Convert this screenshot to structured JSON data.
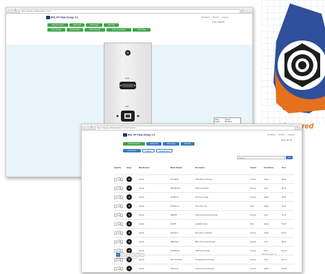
{
  "brand": {
    "tagline": "“Powered",
    "colors": {
      "blue": "#2f4f9a",
      "orange": "#e5711d",
      "camera": "#1d1d1d"
    }
  },
  "back_window": {
    "url": "https://design.rdlfaceplates.com/",
    "app_title": "RDL FP Plate Desigr 2.0",
    "top_links": [
      "Products",
      "Brand",
      "Logout"
    ],
    "toolbar_row1": [
      "Add Connector",
      "Add Label",
      "Add Image",
      "Add Text"
    ],
    "toolbar_row2": [
      "Save Design",
      "Load Design",
      "Order Sample",
      "Order Production",
      "Clear Plate"
    ],
    "price_label": "Price: $60.00",
    "connector_labels": [
      "RGB",
      "USB"
    ],
    "panel": [
      "Plate",
      "Single",
      "Finish",
      "Brushed"
    ]
  },
  "front_window": {
    "url": "https://design.rdlfaceplates.com/connectors",
    "app_title": "RDL FP Plate Desigr 2.0",
    "top_links": [
      "Products",
      "Brand",
      "Logout"
    ],
    "price_label": "Price: $7.78",
    "toolbar_row1": [
      "Add Connector",
      "Add Label",
      "Add Image",
      "Add Text"
    ],
    "tabs": [
      "Connectors",
      "Labels",
      "Accessories"
    ],
    "search_placeholder": "Search",
    "search_button": "Go",
    "columns": [
      "Quantity",
      "Image",
      "Manufacturer",
      "Model Number",
      "Description",
      "Gender",
      "Termination",
      "Price"
    ],
    "rows": [
      [
        "Neutrik",
        "NAUSB-W",
        "USB A/B feed-through",
        "Female",
        "Solder",
        "$8.00"
      ],
      [
        "Neutrik",
        "NAUSB-W-B",
        "USB A to B, black",
        "Female",
        "Feed",
        "$9.20"
      ],
      [
        "Neutrik",
        "NC3FD-LX",
        "XLR 3-pin female",
        "Female",
        "Solder",
        "$6.90"
      ],
      [
        "Neutrik",
        "NC3MD-LX",
        "XLR 3-pin male",
        "Male",
        "Solder",
        "$6.40"
      ],
      [
        "Neutrik",
        "NE8FDP",
        "RJ45 etherCON feed-through",
        "Female",
        "Feed",
        "$7.30"
      ],
      [
        "Neutrik",
        "NL4MP",
        "speakON 4-pole",
        "Male",
        "Solder",
        "$9.80"
      ],
      [
        "Neutrik",
        "NF2D-B-2",
        "RCA phono, red/black",
        "Female",
        "Solder",
        "$4.50"
      ],
      [
        "Neutrik",
        "NBB75DFI",
        "BNC 75 ohm feed-through",
        "Female",
        "Feed",
        "$8.60"
      ],
      [
        "Neutrik",
        "NAHDMI-W",
        "HDMI feed-through",
        "Female",
        "Feed",
        "$12.40"
      ],
      [
        "Neutrik",
        "NA2-IO-DLINE",
        "DisplayPort feed-through",
        "Female",
        "Feed",
        "$14.10"
      ],
      [
        "Neutrik",
        "NAVGA-W",
        "VGA 15-pin feed-through",
        "Female",
        "Solder",
        "$10.20"
      ],
      [
        "Neutrik",
        "NAMDP-W",
        "Mini DisplayPort",
        "Female",
        "Feed",
        "$13.90"
      ]
    ],
    "pager": [
      "1",
      "2",
      "3",
      "4",
      "5",
      "»"
    ],
    "pager_note": "Showing connectors 1 to 12",
    "per_page": "Items per page: 12"
  }
}
